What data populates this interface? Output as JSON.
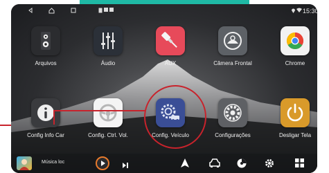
{
  "status": {
    "left_icons": [
      "back-icon",
      "home-icon",
      "recents-icon",
      "tablet-icon",
      "notification-icon",
      "sim-icon"
    ],
    "time": "15:30"
  },
  "apps": [
    {
      "label": "Arquivos",
      "icon": "speaker-icon"
    },
    {
      "label": "Áudio",
      "icon": "equalizer-icon"
    },
    {
      "label": "AUX",
      "icon": "aux-cable-icon"
    },
    {
      "label": "Câmera Frontal",
      "icon": "camera-front-icon"
    },
    {
      "label": "Chrome",
      "icon": "chrome-icon"
    },
    {
      "label": "Config Info Car",
      "icon": "info-icon"
    },
    {
      "label": "Config. Ctrl. Vol.",
      "icon": "steering-wheel-icon"
    },
    {
      "label": "Config. Veículo",
      "icon": "vehicle-settings-icon"
    },
    {
      "label": "Configurações",
      "icon": "settings-gear-icon"
    },
    {
      "label": "Desligar Tela",
      "icon": "power-icon"
    }
  ],
  "dock": {
    "track_title": "Música loc",
    "icons": [
      "album-art",
      "play-icon",
      "next-icon",
      "navigation-icon",
      "car-icon",
      "music-disc-icon",
      "settings-icon",
      "apps-grid-icon"
    ]
  },
  "colors": {
    "teal": "#1fb9a5",
    "highlight": "#c8232c"
  }
}
